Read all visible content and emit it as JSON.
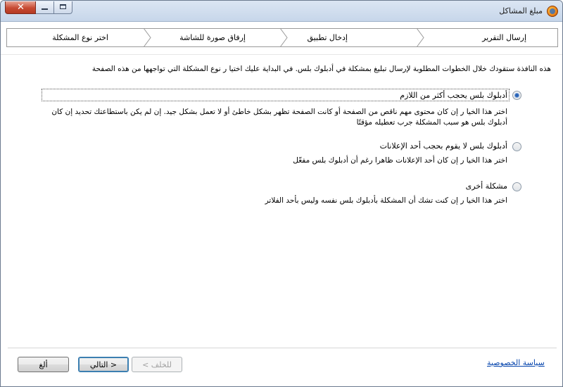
{
  "window": {
    "title": "مبلغ المشاكل"
  },
  "steps": [
    {
      "label": "إرسال التقرير"
    },
    {
      "label": "إدخال تطبيق"
    },
    {
      "label": "إرفاق صورة للشاشة"
    },
    {
      "label": "اختر نوع المشكلة"
    }
  ],
  "intro": "هذه النافذة ستقودك خلال الخطوات المطلوبة لإرسال تبليغ بمشكلة في أدبلوك بلس. في البداية عليك اختيا ر نوع المشكلة التي تواجهها من هذه الصفحة",
  "options": [
    {
      "label": "أدبلوك بلس يحجب أكثر من اللازم",
      "description": "اختر هذا الخيا ر إن كان محتوى مهم ناقص من الصفحة أو كانت الصفحة تظهر بشكل خاطئ أو لا تعمل بشكل جيد. إن لم يكن باستطاعتك تحديد إن كان أدبلوك بلس هو سبب المشكلة جرب تعطيله مؤقتًا",
      "checked": true
    },
    {
      "label": "أدبلوك بلس لا يقوم بحجب أحد الإعلانات",
      "description": "اختر هذا الخيا ر إن كان أحد الإعلانات ظاهرا رغم أن أدبلوك بلس مفعّل",
      "checked": false
    },
    {
      "label": "مشكلة أخرى",
      "description": "اختر هذا الخيا ر إن كنت تشك أن المشكلة بأدبلوك بلس نفسه وليس بأحد الفلاتر",
      "checked": false
    }
  ],
  "footer": {
    "privacy_link": "سياسة الخصوصية",
    "back_label": "< للخلف",
    "next_label": "التالي >",
    "cancel_label": "ألغ"
  },
  "colors": {
    "accent": "#2a63b5",
    "link": "#0645ad",
    "close_button": "#c74a33"
  }
}
